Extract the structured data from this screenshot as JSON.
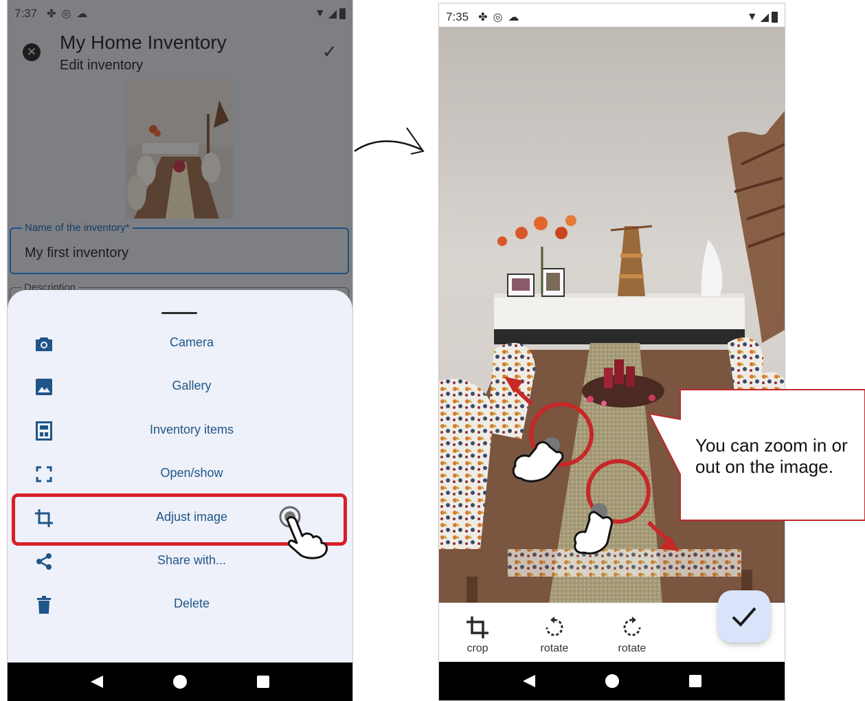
{
  "left_screen": {
    "status": {
      "time": "7:37"
    },
    "header": {
      "title": "My Home Inventory",
      "subtitle": "Edit inventory"
    },
    "name_field": {
      "label": "Name of the inventory*",
      "value": "My first inventory"
    },
    "description_field": {
      "label": "Description"
    },
    "sheet_menu": {
      "items": [
        {
          "label": "Camera",
          "icon": "camera-icon"
        },
        {
          "label": "Gallery",
          "icon": "image-icon"
        },
        {
          "label": "Inventory items",
          "icon": "inventory-items-icon"
        },
        {
          "label": "Open/show",
          "icon": "fullscreen-icon"
        },
        {
          "label": "Adjust image",
          "icon": "crop-icon"
        },
        {
          "label": "Share with...",
          "icon": "share-icon"
        },
        {
          "label": "Delete",
          "icon": "trash-icon"
        }
      ],
      "highlighted": "Adjust image"
    }
  },
  "right_screen": {
    "status": {
      "time": "7:35"
    },
    "tools": [
      {
        "label": "crop",
        "icon": "crop-icon"
      },
      {
        "label": "rotate",
        "icon": "rotate-left-icon"
      },
      {
        "label": "rotate",
        "icon": "rotate-right-icon"
      }
    ],
    "callout": "You can zoom in or out on the image."
  },
  "colors": {
    "accent": "#1f5588",
    "highlight": "#d81f26",
    "dim_overlay": "#7d7f83",
    "sheet_bg": "#eef1f9",
    "fab_bg": "#d9e4fb"
  }
}
